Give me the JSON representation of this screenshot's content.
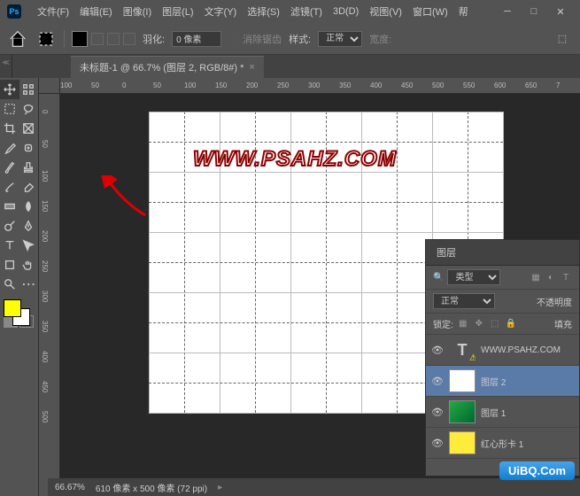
{
  "titlebar": {
    "menu": [
      "文件(F)",
      "编辑(E)",
      "图像(I)",
      "图层(L)",
      "文字(Y)",
      "选择(S)",
      "滤镜(T)",
      "3D(D)",
      "视图(V)",
      "窗口(W)",
      "帮"
    ]
  },
  "options": {
    "feather_label": "羽化:",
    "feather_value": "0 像素",
    "antialias": "消除锯齿",
    "style_label": "样式:",
    "style_value": "正常",
    "width_label": "宽度:"
  },
  "tab": {
    "title": "未标题-1 @ 66.7% (图层 2, RGB/8#) *",
    "close": "×"
  },
  "ruler_h": [
    "100",
    "50",
    "0",
    "50",
    "100",
    "150",
    "200",
    "250",
    "300",
    "350",
    "400",
    "450",
    "500",
    "550",
    "600",
    "650",
    "7"
  ],
  "ruler_v": [
    "0",
    "50",
    "100",
    "150",
    "200",
    "250",
    "300",
    "350",
    "400",
    "450",
    "500"
  ],
  "watermark": "WWW.PSAHZ.COM",
  "status": {
    "zoom": "66.67%",
    "docsize": "610 像素 x 500 像素 (72 ppi)"
  },
  "layers": {
    "title": "图层",
    "filter_label": "类型",
    "blend_mode": "正常",
    "opacity_label": "不透明度",
    "lock_label": "锁定:",
    "fill_label": "填充",
    "items": [
      {
        "name": "WWW.PSAHZ.COM",
        "type": "text"
      },
      {
        "name": "图层 2",
        "type": "white"
      },
      {
        "name": "图层 1",
        "type": "image"
      },
      {
        "name": "红心形卡 1",
        "type": "yellow"
      }
    ]
  },
  "brand": "UiBQ.Com"
}
